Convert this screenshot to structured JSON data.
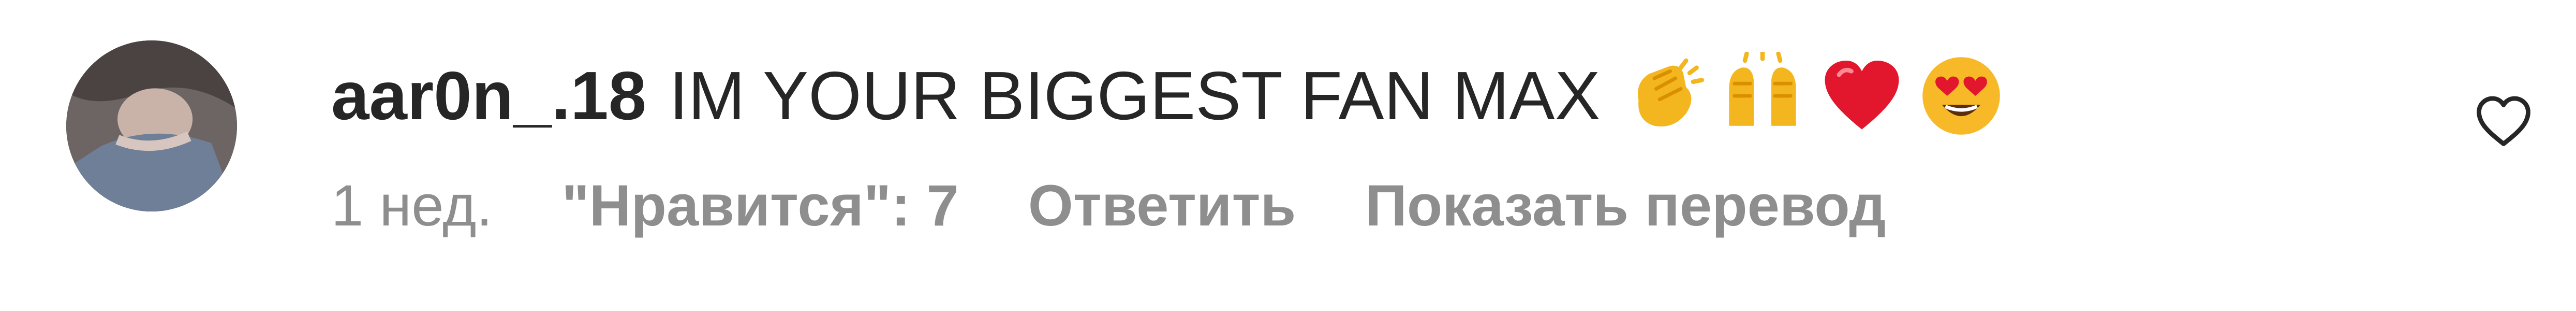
{
  "comment": {
    "username": "aar0n_.18",
    "text": "IM YOUR BIGGEST FAN MAX",
    "emojis": [
      {
        "name": "clapping-hands-emoji",
        "char": "👏"
      },
      {
        "name": "raising-hands-emoji",
        "char": "🙌"
      },
      {
        "name": "red-heart-emoji",
        "char": "❤"
      },
      {
        "name": "heart-eyes-emoji",
        "char": "😍"
      }
    ],
    "meta": {
      "time": "1 нед.",
      "likes": "\"Нравится\": 7",
      "reply_label": "Ответить",
      "translate_label": "Показать перевод"
    }
  },
  "colors": {
    "text_primary": "#262626",
    "text_secondary": "#8e8e8e",
    "background": "#ffffff"
  },
  "icons": {
    "like": "heart-outline-icon"
  }
}
